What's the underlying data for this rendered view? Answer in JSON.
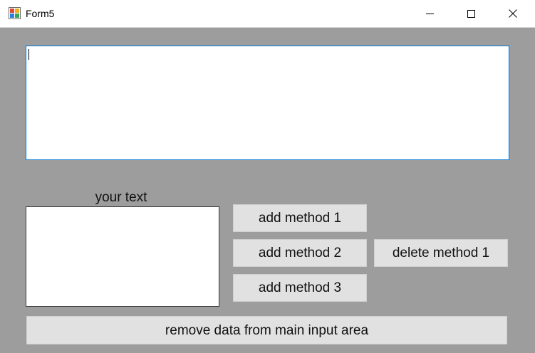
{
  "window": {
    "title": "Form5"
  },
  "main_input": {
    "value": ""
  },
  "your_text_label": "your text",
  "your_text_box": {
    "value": ""
  },
  "buttons": {
    "add_method_1": "add method 1",
    "add_method_2": "add method 2",
    "add_method_3": "add method 3",
    "delete_method_1": "delete method 1",
    "remove_data": "remove data from main input area"
  },
  "icons": {
    "app_icon": "winforms-form-icon",
    "minimize": "minimize-icon",
    "maximize": "maximize-icon",
    "close": "close-icon"
  },
  "colors": {
    "form_background": "#9d9d9d",
    "button_face": "#e1e1e1",
    "focus_border": "#0078d7"
  }
}
